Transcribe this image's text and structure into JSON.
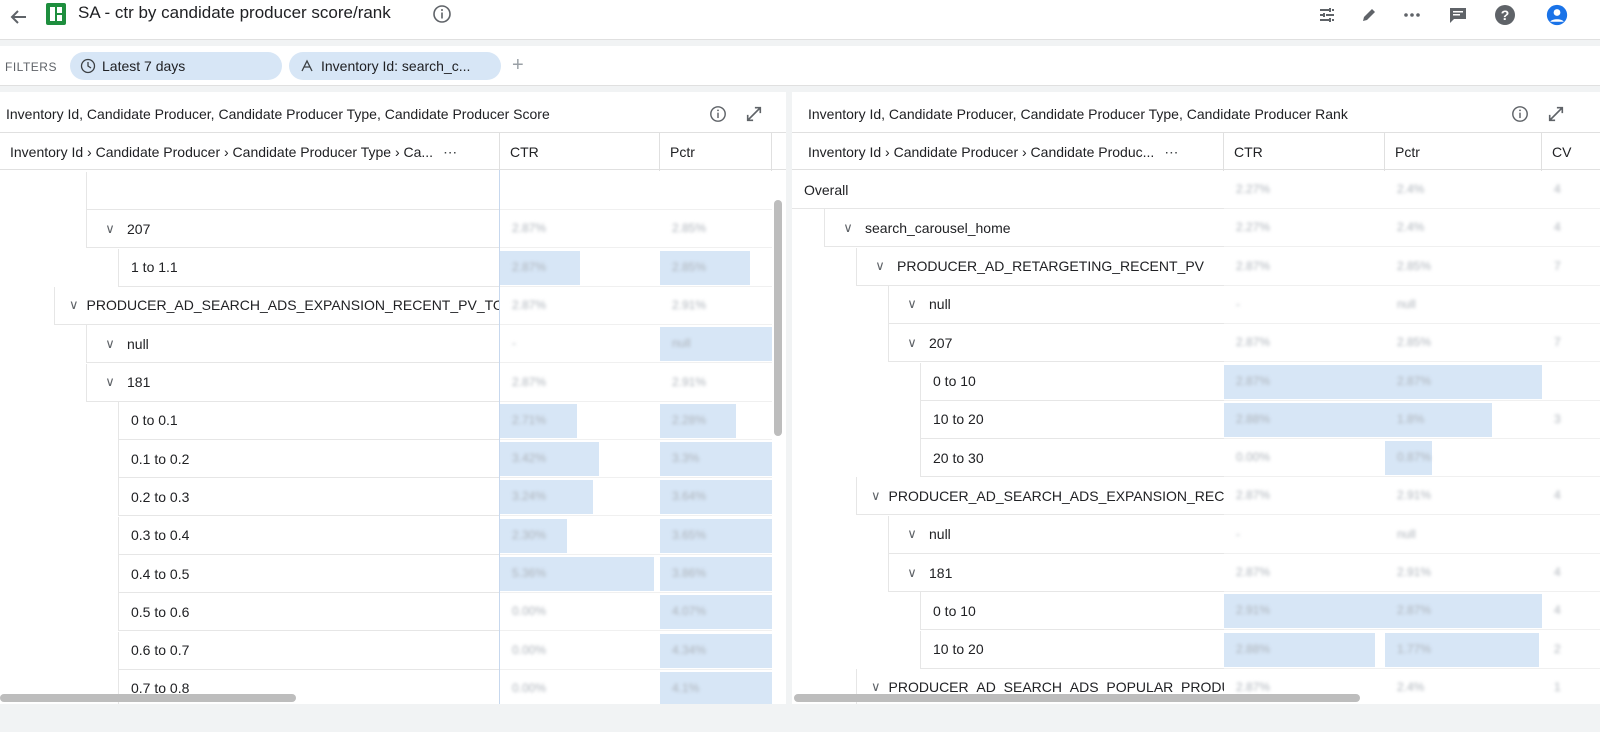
{
  "header": {
    "title": "SA - ctr by candidate producer score/rank"
  },
  "filters": {
    "label": "FILTERS",
    "chips": [
      {
        "label": "Latest 7 days"
      },
      {
        "label": "Inventory Id: search_c..."
      }
    ],
    "add": "+"
  },
  "left_panel": {
    "title": "Inventory Id, Candidate Producer, Candidate Producer Type, Candidate Producer Score",
    "columns": [
      "Inventory Id › Candidate Producer › Candidate Producer Type › Ca...",
      "CTR",
      "Pctr"
    ],
    "more": "⋯",
    "rows": [
      {
        "label": "",
        "indent": 2,
        "chevron": false,
        "ctr": "",
        "pctr": "",
        "ctr_fill": 0,
        "pctr_fill": 0
      },
      {
        "label": "207",
        "indent": 2,
        "chevron": true,
        "ctr": "2.87%",
        "pctr": "2.85%",
        "ctr_fill": 0,
        "pctr_fill": 0
      },
      {
        "label": "1 to 1.1",
        "indent": 3,
        "chevron": false,
        "ctr": "2.87%",
        "pctr": "2.85%",
        "ctr_fill": 0.5,
        "pctr_fill": 0.8
      },
      {
        "label": "PRODUCER_AD_SEARCH_ADS_EXPANSION_RECENT_PV_TO_AL...",
        "indent": 1,
        "chevron": true,
        "ctr": "2.87%",
        "pctr": "2.91%",
        "ctr_fill": 0,
        "pctr_fill": 0
      },
      {
        "label": "null",
        "indent": 2,
        "chevron": true,
        "ctr": "-",
        "pctr": "null",
        "ctr_fill": 0,
        "pctr_fill": 1
      },
      {
        "label": "181",
        "indent": 2,
        "chevron": true,
        "ctr": "2.87%",
        "pctr": "2.91%",
        "ctr_fill": 0,
        "pctr_fill": 0
      },
      {
        "label": "0 to 0.1",
        "indent": 3,
        "chevron": false,
        "ctr": "2.71%",
        "pctr": "2.28%",
        "ctr_fill": 0.48,
        "pctr_fill": 0.68
      },
      {
        "label": "0.1 to 0.2",
        "indent": 3,
        "chevron": false,
        "ctr": "3.42%",
        "pctr": "3.3%",
        "ctr_fill": 0.62,
        "pctr_fill": 1
      },
      {
        "label": "0.2 to 0.3",
        "indent": 3,
        "chevron": false,
        "ctr": "3.24%",
        "pctr": "3.64%",
        "ctr_fill": 0.58,
        "pctr_fill": 1
      },
      {
        "label": "0.3 to 0.4",
        "indent": 3,
        "chevron": false,
        "ctr": "2.30%",
        "pctr": "3.65%",
        "ctr_fill": 0.42,
        "pctr_fill": 1
      },
      {
        "label": "0.4 to 0.5",
        "indent": 3,
        "chevron": false,
        "ctr": "5.36%",
        "pctr": "3.86%",
        "ctr_fill": 0.96,
        "pctr_fill": 1
      },
      {
        "label": "0.5 to 0.6",
        "indent": 3,
        "chevron": false,
        "ctr": "0.00%",
        "pctr": "4.07%",
        "ctr_fill": 0,
        "pctr_fill": 1
      },
      {
        "label": "0.6 to 0.7",
        "indent": 3,
        "chevron": false,
        "ctr": "0.00%",
        "pctr": "4.34%",
        "ctr_fill": 0,
        "pctr_fill": 1
      },
      {
        "label": "0.7 to 0.8",
        "indent": 3,
        "chevron": false,
        "ctr": "0.00%",
        "pctr": "4.1%",
        "ctr_fill": 0,
        "pctr_fill": 1
      },
      {
        "label": "",
        "indent": 3,
        "chevron": false,
        "ctr": "",
        "pctr": "",
        "ctr_fill": 0,
        "pctr_fill": 1
      }
    ]
  },
  "right_panel": {
    "title": "Inventory Id, Candidate Producer, Candidate Producer Type, Candidate Producer Rank",
    "columns": [
      "Inventory Id › Candidate Producer › Candidate Produc...",
      "CTR",
      "Pctr",
      "CV"
    ],
    "more": "⋯",
    "rows": [
      {
        "label": "Overall",
        "indent": 0,
        "chevron": false,
        "ctr": "2.27%",
        "pctr": "2.4%",
        "cv": "4",
        "ctr_fill": 0,
        "pctr_fill": 0
      },
      {
        "label": "search_carousel_home",
        "indent": 1,
        "chevron": true,
        "ctr": "2.27%",
        "pctr": "2.4%",
        "cv": "4",
        "ctr_fill": 0,
        "pctr_fill": 0
      },
      {
        "label": "PRODUCER_AD_RETARGETING_RECENT_PV",
        "indent": 2,
        "chevron": true,
        "ctr": "2.87%",
        "pctr": "2.85%",
        "cv": "7",
        "ctr_fill": 0,
        "pctr_fill": 0
      },
      {
        "label": "null",
        "indent": 3,
        "chevron": true,
        "ctr": "-",
        "pctr": "null",
        "cv": "",
        "ctr_fill": 0,
        "pctr_fill": 0
      },
      {
        "label": "207",
        "indent": 3,
        "chevron": true,
        "ctr": "2.87%",
        "pctr": "2.85%",
        "cv": "7",
        "ctr_fill": 0,
        "pctr_fill": 0
      },
      {
        "label": "0 to 10",
        "indent": 4,
        "chevron": false,
        "ctr": "2.87%",
        "pctr": "2.87%",
        "cv": "",
        "ctr_fill": 1,
        "pctr_fill": 1
      },
      {
        "label": "10 to 20",
        "indent": 4,
        "chevron": false,
        "ctr": "2.88%",
        "pctr": "1.8%",
        "cv": "3",
        "ctr_fill": 1,
        "pctr_fill": 0.68
      },
      {
        "label": "20 to 30",
        "indent": 4,
        "chevron": false,
        "ctr": "0.00%",
        "pctr": "0.87%",
        "cv": "",
        "ctr_fill": 0,
        "pctr_fill": 0.3
      },
      {
        "label": "PRODUCER_AD_SEARCH_ADS_EXPANSION_RECEN...",
        "indent": 2,
        "chevron": true,
        "ctr": "2.87%",
        "pctr": "2.91%",
        "cv": "4",
        "ctr_fill": 0,
        "pctr_fill": 0
      },
      {
        "label": "null",
        "indent": 3,
        "chevron": true,
        "ctr": "-",
        "pctr": "null",
        "cv": "",
        "ctr_fill": 0,
        "pctr_fill": 0
      },
      {
        "label": "181",
        "indent": 3,
        "chevron": true,
        "ctr": "2.87%",
        "pctr": "2.91%",
        "cv": "4",
        "ctr_fill": 0,
        "pctr_fill": 0
      },
      {
        "label": "0 to 10",
        "indent": 4,
        "chevron": false,
        "ctr": "2.91%",
        "pctr": "2.87%",
        "cv": "4",
        "ctr_fill": 1,
        "pctr_fill": 1
      },
      {
        "label": "10 to 20",
        "indent": 4,
        "chevron": false,
        "ctr": "2.88%",
        "pctr": "1.77%",
        "cv": "2",
        "ctr_fill": 0.94,
        "pctr_fill": 0.98
      },
      {
        "label": "PRODUCER_AD_SEARCH_ADS_POPULAR_PRODUCT",
        "indent": 2,
        "chevron": true,
        "ctr": "2.87%",
        "pctr": "2.4%",
        "cv": "1",
        "ctr_fill": 0,
        "pctr_fill": 0
      }
    ]
  },
  "colors": {
    "accent": "#1e8e3e",
    "bar": "#d7e6f6",
    "chip": "#d7e6f6"
  }
}
